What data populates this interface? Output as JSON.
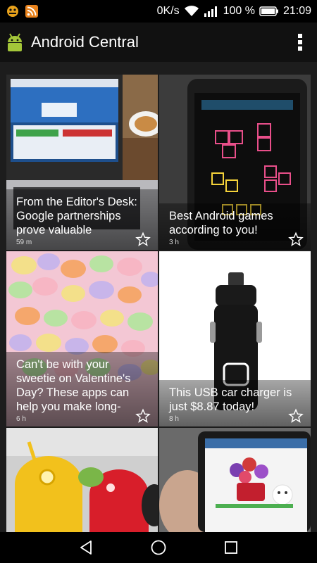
{
  "status_bar": {
    "speed": "0K/s",
    "battery_percent": "100 %",
    "time": "21:09",
    "icons": [
      "android-status-icon",
      "rss-icon",
      "wifi-icon",
      "signal-icon",
      "battery-icon"
    ]
  },
  "app_bar": {
    "title": "Android Central",
    "logo_icon": "android-logo-icon",
    "menu_icon": "overflow-menu-icon"
  },
  "articles": [
    {
      "headline": "From the Editor's Desk: Google partnerships prove valuable",
      "time": "59 m"
    },
    {
      "headline": "Best Android games according to you!",
      "time": "3 h"
    },
    {
      "headline": "Can't be with your sweetie on Valentine's Day? These apps can help you make long-",
      "time": "6 h"
    },
    {
      "headline": "This USB car charger is just $8.87 today!",
      "time": "8 h"
    },
    {
      "headline": "",
      "time": ""
    },
    {
      "headline": "",
      "time": ""
    }
  ],
  "nav_bar": {
    "back_icon": "back-icon",
    "home_icon": "home-icon",
    "recents_icon": "recents-icon"
  },
  "colors": {
    "background": "#000000",
    "grid_background": "#1d1d1d",
    "android_green": "#a4c639"
  }
}
